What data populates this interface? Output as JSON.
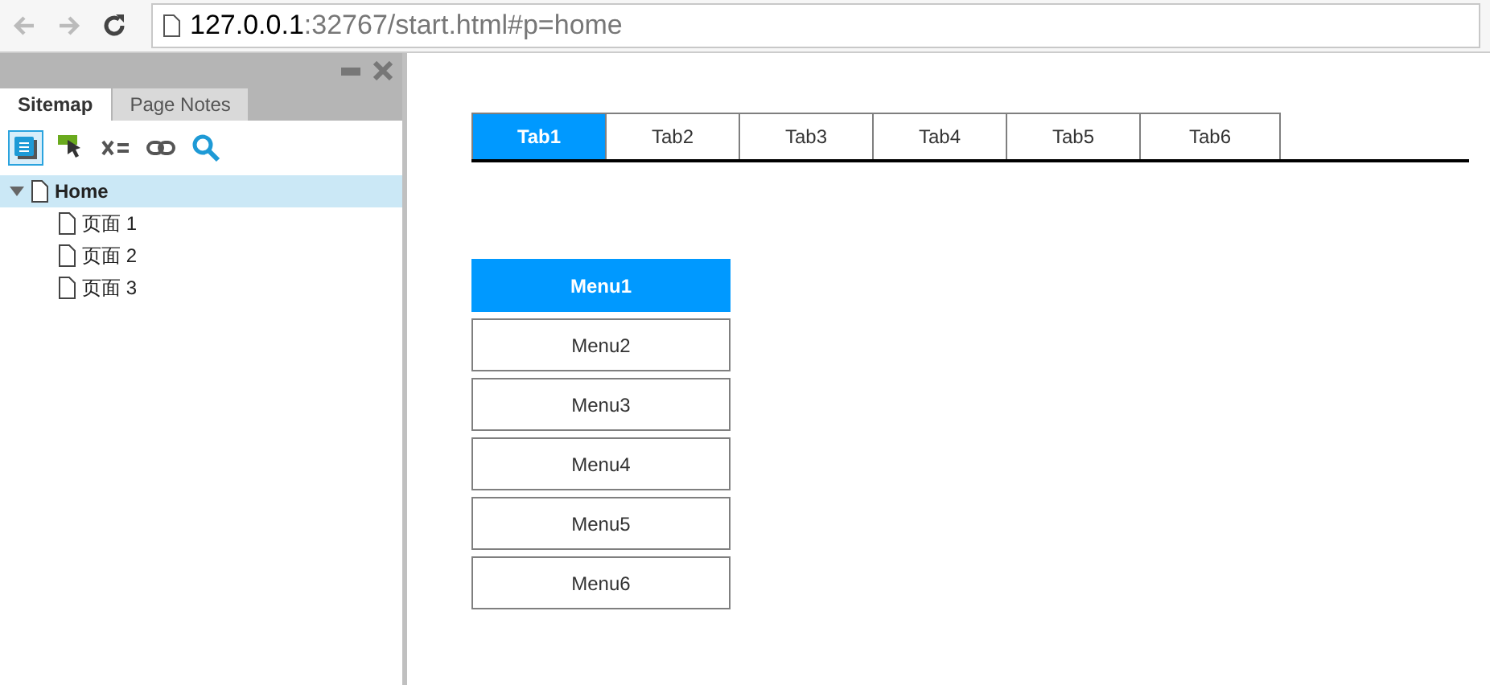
{
  "browser": {
    "url_host": "127.0.0.1",
    "url_rest": ":32767/start.html#p=home"
  },
  "sidebar": {
    "tabs": [
      {
        "label": "Sitemap",
        "selected": true
      },
      {
        "label": "Page Notes",
        "selected": false
      }
    ],
    "tree": [
      {
        "label": "Home",
        "selected": true,
        "expanded": true,
        "children": [
          {
            "label": "页面 1",
            "selected": false
          },
          {
            "label": "页面 2",
            "selected": false
          },
          {
            "label": "页面 3",
            "selected": false
          }
        ]
      }
    ]
  },
  "tabs": [
    {
      "label": "Tab1",
      "selected": true
    },
    {
      "label": "Tab2",
      "selected": false
    },
    {
      "label": "Tab3",
      "selected": false
    },
    {
      "label": "Tab4",
      "selected": false
    },
    {
      "label": "Tab5",
      "selected": false
    },
    {
      "label": "Tab6",
      "selected": false
    }
  ],
  "menu": [
    {
      "label": "Menu1",
      "selected": true
    },
    {
      "label": "Menu2",
      "selected": false
    },
    {
      "label": "Menu3",
      "selected": false
    },
    {
      "label": "Menu4",
      "selected": false
    },
    {
      "label": "Menu5",
      "selected": false
    },
    {
      "label": "Menu6",
      "selected": false
    }
  ]
}
